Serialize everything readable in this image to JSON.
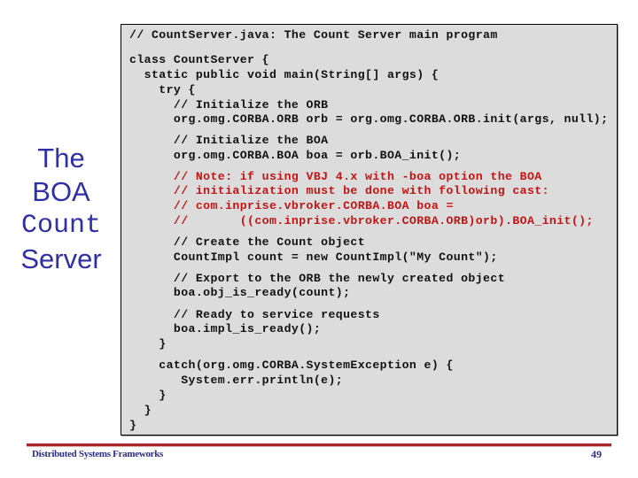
{
  "slide": {
    "side_title": {
      "line1": "The",
      "line2": "BOA",
      "line3": "Count",
      "line4": "Server"
    },
    "code": [
      {
        "text": "// CountServer.java: The Count Server main program",
        "color": "black"
      },
      {
        "text": "class CountServer {",
        "color": "black"
      },
      {
        "text": "  static public void main(String[] args) {",
        "color": "black"
      },
      {
        "text": "    try {",
        "color": "black"
      },
      {
        "text": "      // Initialize the ORB",
        "color": "black"
      },
      {
        "text": "      org.omg.CORBA.ORB orb = org.omg.CORBA.ORB.init(args, null);",
        "color": "black"
      },
      {
        "text": "      // Initialize the BOA",
        "color": "black"
      },
      {
        "text": "      org.omg.CORBA.BOA boa = orb.BOA_init();",
        "color": "black"
      },
      {
        "text": "      // Note: if using VBJ 4.x with -boa option the BOA",
        "color": "red"
      },
      {
        "text": "      // initialization must be done with following cast:",
        "color": "red"
      },
      {
        "text": "      // com.inprise.vbroker.CORBA.BOA boa =",
        "color": "red"
      },
      {
        "text": "      //       ((com.inprise.vbroker.CORBA.ORB)orb).BOA_init();",
        "color": "red"
      },
      {
        "text": "      // Create the Count object",
        "color": "black"
      },
      {
        "text": "      CountImpl count = new CountImpl(\"My Count\");",
        "color": "black"
      },
      {
        "text": "      // Export to the ORB the newly created object",
        "color": "black"
      },
      {
        "text": "      boa.obj_is_ready(count);",
        "color": "black"
      },
      {
        "text": "      // Ready to service requests",
        "color": "black"
      },
      {
        "text": "      boa.impl_is_ready();",
        "color": "black"
      },
      {
        "text": "    }",
        "color": "black"
      },
      {
        "text": "    catch(org.omg.CORBA.SystemException e) {",
        "color": "black"
      },
      {
        "text": "       System.err.println(e);",
        "color": "black"
      },
      {
        "text": "    }",
        "color": "black"
      },
      {
        "text": "  }",
        "color": "black"
      },
      {
        "text": "}",
        "color": "black"
      }
    ],
    "footer": {
      "course": "Distributed Systems Frameworks",
      "page_number": "49"
    },
    "colors": {
      "title_blue": "#2f2fa8",
      "comment_red": "#c21414",
      "rule_red": "#a8262e",
      "box_gray": "#dcdcdc"
    }
  }
}
